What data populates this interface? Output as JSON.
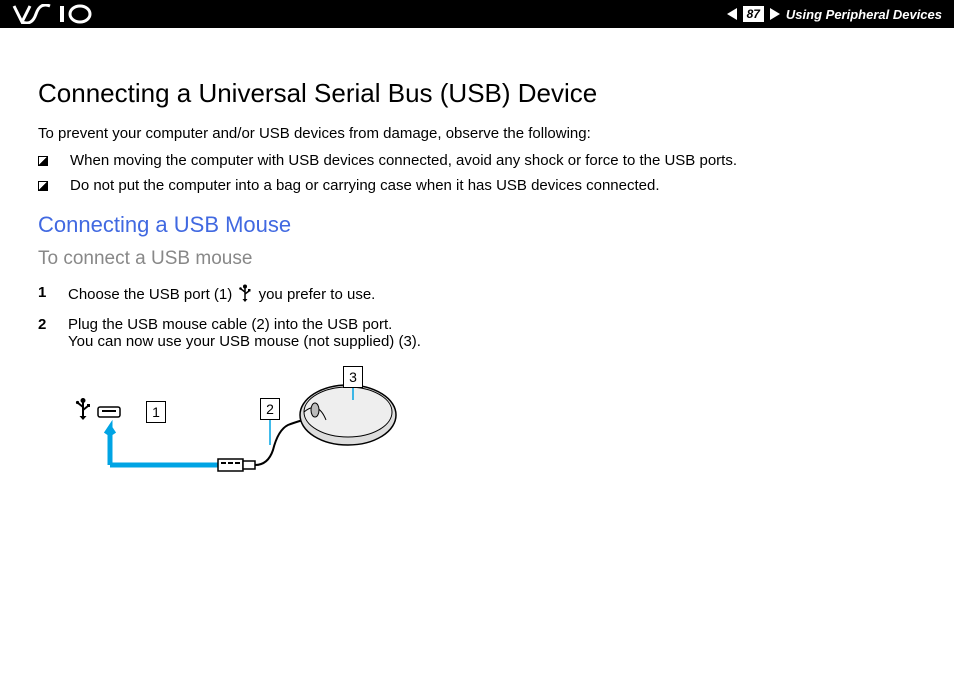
{
  "header": {
    "page_number": "87",
    "title": "Using Peripheral Devices"
  },
  "content": {
    "main_heading": "Connecting a Universal Serial Bus (USB) Device",
    "intro": "To prevent your computer and/or USB devices from damage, observe the following:",
    "bullets": [
      "When moving the computer with USB devices connected, avoid any shock or force to the USB ports.",
      "Do not put the computer into a bag or carrying case when it has USB devices connected."
    ],
    "sub_heading_blue": "Connecting a USB Mouse",
    "sub_heading_gray": "To connect a USB mouse",
    "steps": [
      {
        "num": "1",
        "text_before": "Choose the USB port (1) ",
        "text_after": " you prefer to use."
      },
      {
        "num": "2",
        "text_before": "Plug the USB mouse cable (2) into the USB port.",
        "text_line2": "You can now use your USB mouse (not supplied) (3)."
      }
    ],
    "callouts": {
      "c1": "1",
      "c2": "2",
      "c3": "3"
    }
  }
}
